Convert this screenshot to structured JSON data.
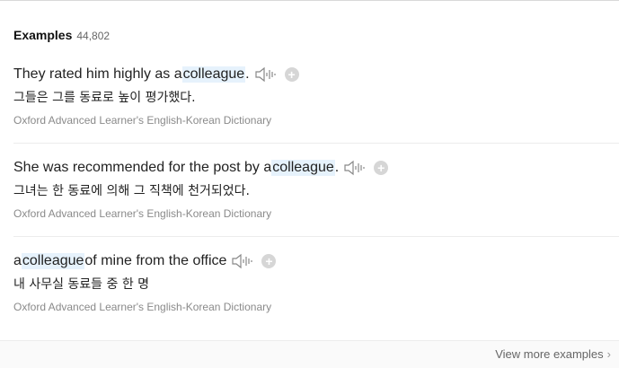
{
  "header": {
    "title": "Examples",
    "count": "44,802"
  },
  "examples": [
    {
      "before": "They rated him highly as a ",
      "highlight": "colleague",
      "after": ".",
      "translation": "그들은 그를 동료로 높이 평가했다.",
      "source": "Oxford Advanced Learner's English-Korean Dictionary"
    },
    {
      "before": "She was recommended for the post by a ",
      "highlight": "colleague",
      "after": ".",
      "translation": "그녀는 한 동료에 의해 그 직책에 천거되었다.",
      "source": "Oxford Advanced Learner's English-Korean Dictionary"
    },
    {
      "before": "a ",
      "highlight": "colleague",
      "after": " of mine from the office",
      "translation": "내 사무실 동료들 중 한 명",
      "source": "Oxford Advanced Learner's English-Korean Dictionary"
    }
  ],
  "footer": {
    "more_label": "View more examples",
    "chevron": "›"
  },
  "icons": {
    "speaker": "speaker-icon",
    "add": "plus-icon"
  },
  "colors": {
    "highlight": "#e6f2fc"
  }
}
